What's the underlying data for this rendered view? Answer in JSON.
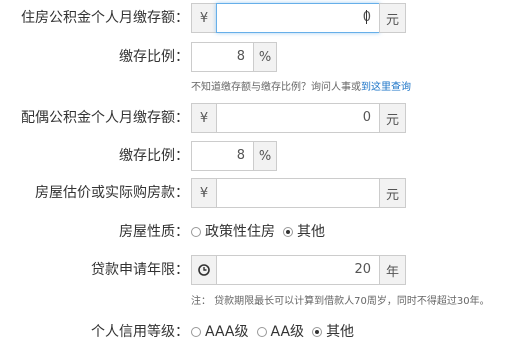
{
  "personal": {
    "label": "住房公积金个人月缴存额：",
    "currency": "¥",
    "value": "0",
    "unit": "元"
  },
  "personal_ratio": {
    "label": "缴存比例：",
    "value": "8",
    "unit": "%"
  },
  "hint": {
    "text": "不知道缴存额与缴存比例？询问人事或",
    "link": "到这里查询"
  },
  "spouse": {
    "label": "配偶公积金个人月缴存额：",
    "currency": "¥",
    "value": "0",
    "unit": "元"
  },
  "spouse_ratio": {
    "label": "缴存比例：",
    "value": "8",
    "unit": "%"
  },
  "house_price": {
    "label": "房屋估价或实际购房款：",
    "currency": "¥",
    "value": "",
    "unit": "元"
  },
  "house_type": {
    "label": "房屋性质：",
    "options": [
      "政策性住房",
      "其他"
    ],
    "selected": "其他"
  },
  "loan_years": {
    "label": "贷款申请年限：",
    "value": "20",
    "unit": "年",
    "icon": "clock-icon"
  },
  "note": {
    "text": "注： 贷款期限最长可以计算到借款人70周岁，同时不得超过30年。"
  },
  "credit": {
    "label": "个人信用等级：",
    "options": [
      "AAA级",
      "AA级",
      "其他"
    ],
    "selected": "其他"
  },
  "colors": {
    "focus_border": "#66afe9",
    "link": "#1a73c7"
  }
}
